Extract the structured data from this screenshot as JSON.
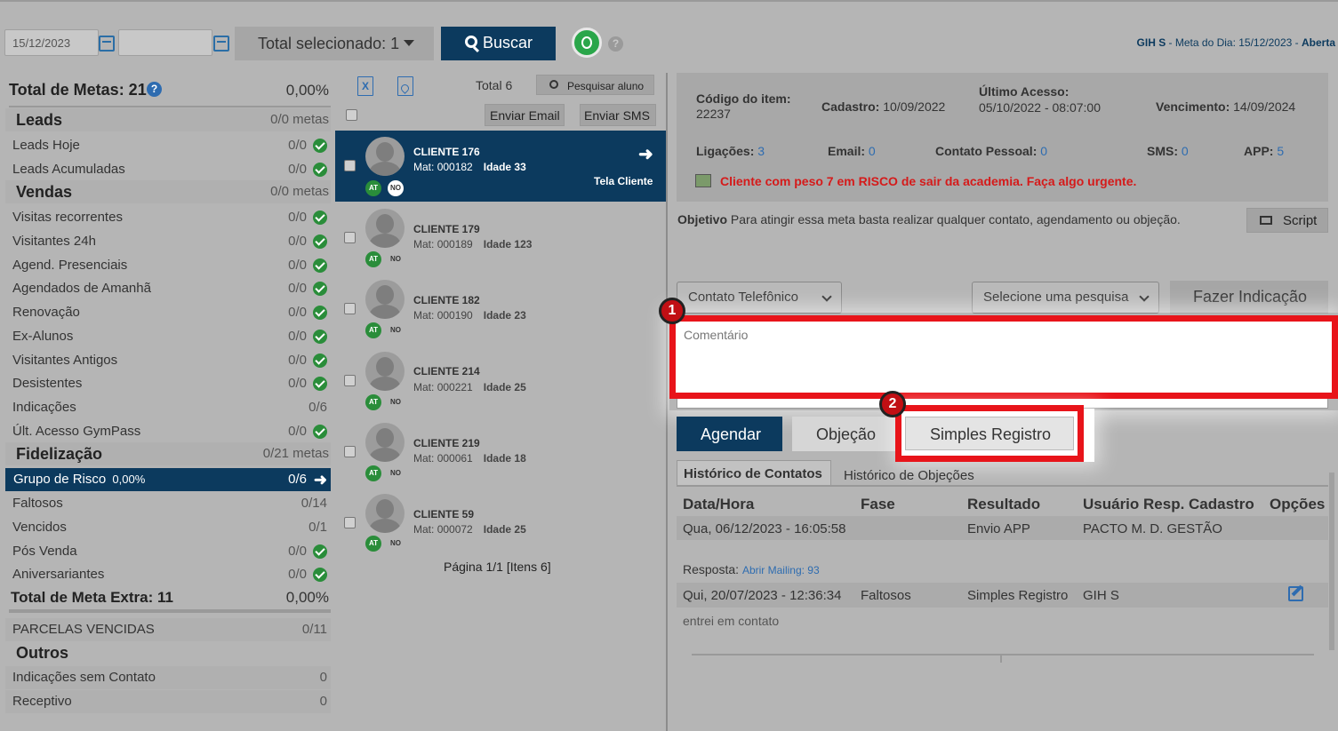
{
  "topbar": {
    "date_value": "15/12/2023",
    "date2_value": "",
    "total_selecionado": "Total selecionado: 1",
    "buscar": "Buscar",
    "help": "?",
    "status_user": "GIH S",
    "status_rest": " - Meta do Dia: 15/12/2023 - ",
    "status_state": "Aberta"
  },
  "left": {
    "total_metas": "Total de Metas: 21",
    "total_pct": "0,00%",
    "leads": {
      "title": "Leads",
      "value": "0/0 metas"
    },
    "leads_items": [
      {
        "label": "Leads Hoje",
        "value": "0/0"
      },
      {
        "label": "Leads Acumuladas",
        "value": "0/0"
      }
    ],
    "vendas": {
      "title": "Vendas",
      "value": "0/0 metas"
    },
    "vendas_items": [
      {
        "label": "Visitas recorrentes",
        "value": "0/0"
      },
      {
        "label": "Visitantes 24h",
        "value": "0/0"
      },
      {
        "label": "Agend. Presenciais",
        "value": "0/0"
      },
      {
        "label": "Agendados de Amanhã",
        "value": "0/0"
      },
      {
        "label": "Renovação",
        "value": "0/0"
      },
      {
        "label": "Ex-Alunos",
        "value": "0/0"
      },
      {
        "label": "Visitantes Antigos",
        "value": "0/0"
      },
      {
        "label": "Desistentes",
        "value": "0/0"
      },
      {
        "label": "Indicações",
        "value": "0/6"
      },
      {
        "label": "Últ. Acesso GymPass",
        "value": "0/0"
      }
    ],
    "fidelizacao": {
      "title": "Fidelização",
      "value": "0/21 metas"
    },
    "fid_selected": {
      "label": "Grupo de Risco",
      "pct": "0,00%",
      "value": "0/6"
    },
    "fid_items": [
      {
        "label": "Faltosos",
        "value": "0/14"
      },
      {
        "label": "Vencidos",
        "value": "0/1"
      },
      {
        "label": "Pós Venda",
        "value": "0/0"
      },
      {
        "label": "Aniversariantes",
        "value": "0/0"
      }
    ],
    "meta_extra": "Total de Meta Extra: 11",
    "meta_extra_pct": "0,00%",
    "parcelas": {
      "label": "PARCELAS VENCIDAS",
      "value": "0/11"
    },
    "outros": {
      "title": "Outros"
    },
    "outros_items": [
      {
        "label": "Indicações sem Contato",
        "value": "0"
      },
      {
        "label": "Receptivo",
        "value": "0"
      }
    ]
  },
  "mid": {
    "total": "Total 6",
    "pesquisar": "Pesquisar aluno",
    "enviar_email": "Enviar Email",
    "enviar_sms": "Enviar SMS",
    "tela_cliente": "Tela Cliente",
    "mat_label": "Mat:",
    "idade_label": "Idade",
    "badge_at": "AT",
    "badge_no": "NO",
    "clients": [
      {
        "name": "CLIENTE 176",
        "mat": "000182",
        "idade": "33"
      },
      {
        "name": "CLIENTE 179",
        "mat": "000189",
        "idade": "123"
      },
      {
        "name": "CLIENTE 182",
        "mat": "000190",
        "idade": "23"
      },
      {
        "name": "CLIENTE 214",
        "mat": "000221",
        "idade": "25"
      },
      {
        "name": "CLIENTE 219",
        "mat": "000061",
        "idade": "18"
      },
      {
        "name": "CLIENTE 59",
        "mat": "000072",
        "idade": "25"
      }
    ],
    "pagina": "Página 1/1 [Itens 6]"
  },
  "right": {
    "codigo_label": "Código do item:",
    "codigo_value": "22237",
    "cadastro_label": "Cadastro:",
    "cadastro_value": "10/09/2022",
    "ultimo_label": "Último Acesso:",
    "ultimo_value": "05/10/2022 - 08:07:00",
    "vencimento_label": "Vencimento:",
    "vencimento_value": "14/09/2024",
    "ligacoes_label": "Ligações:",
    "ligacoes_value": "3",
    "email_label": "Email:",
    "email_value": "0",
    "contato_label": "Contato Pessoal:",
    "contato_value": "0",
    "sms_label": "SMS:",
    "sms_value": "0",
    "app_label": "APP:",
    "app_value": "5",
    "alerta": "Cliente com peso 7 em RISCO de sair da academia. Faça algo urgente.",
    "objetivo_label": "Objetivo",
    "objetivo_text": "Para atingir essa meta basta realizar qualquer contato, agendamento ou objeção.",
    "script": "Script",
    "contato_tipo": "Contato Telefônico",
    "pesquisa": "Selecione uma pesquisa",
    "fazer_indicacao": "Fazer Indicação",
    "comentario_placeholder": "Comentário",
    "badge1": "1",
    "badge2": "2",
    "agendar": "Agendar",
    "objecao": "Objeção",
    "simples_registro": "Simples Registro",
    "tab_hist_contatos": "Histórico de Contatos",
    "tab_hist_objecoes": "Histórico de Objeções",
    "columns": [
      "Data/Hora",
      "Fase",
      "Resultado",
      "Usuário Resp. Cadastro",
      "Opções"
    ],
    "rows": [
      {
        "data": "Qua, 06/12/2023 - 16:05:58",
        "fase": "",
        "resultado": "Envio APP",
        "usuario": "PACTO M. D. GESTÃO"
      },
      {
        "data": "Qui, 20/07/2023 - 12:36:34",
        "fase": "Faltosos",
        "resultado": "Simples Registro",
        "usuario": "GIH S"
      }
    ],
    "resposta_label": "Resposta:",
    "resposta_value": "Abrir Mailing: 93",
    "comentario_row": "entrei em contato"
  }
}
